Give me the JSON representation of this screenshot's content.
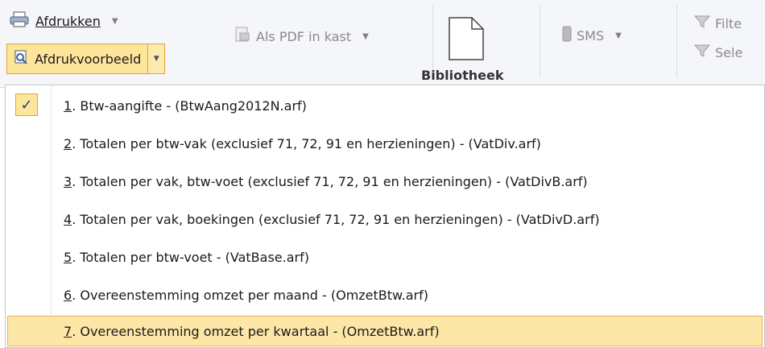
{
  "ribbon": {
    "print_label": "Afdrukken",
    "print_preview_label": "Afdrukvoorbeeld",
    "pdf_label": "Als PDF in kast",
    "library_label": "Bibliotheek",
    "sms_label": "SMS",
    "filter_label": "Filte",
    "select_label": "Sele"
  },
  "menu": {
    "items": [
      {
        "number": "1",
        "text": ". Btw-aangifte  -  (BtwAang2012N.arf)",
        "checked": true
      },
      {
        "number": "2",
        "text": ". Totalen per btw-vak (exclusief 71, 72, 91 en herzieningen)  -  (VatDiv.arf)",
        "checked": false
      },
      {
        "number": "3",
        "text": ". Totalen per vak, btw-voet (exclusief 71, 72, 91 en herzieningen)  -  (VatDivB.arf)",
        "checked": false
      },
      {
        "number": "4",
        "text": ". Totalen per vak, boekingen (exclusief 71, 72, 91 en herzieningen)  -  (VatDivD.arf)",
        "checked": false
      },
      {
        "number": "5",
        "text": ". Totalen per btw-voet  -  (VatBase.arf)",
        "checked": false
      },
      {
        "number": "6",
        "text": ". Overeenstemming omzet per maand  -  (OmzetBtw.arf)",
        "checked": false
      },
      {
        "number": "7",
        "text": ". Overeenstemming omzet per kwartaal  -  (OmzetBtw.arf)",
        "checked": false
      }
    ],
    "check_glyph": "✓"
  },
  "colors": {
    "highlight": "#fde7a7",
    "highlight_border": "#e3b35b",
    "check_color": "#1f3b84"
  }
}
